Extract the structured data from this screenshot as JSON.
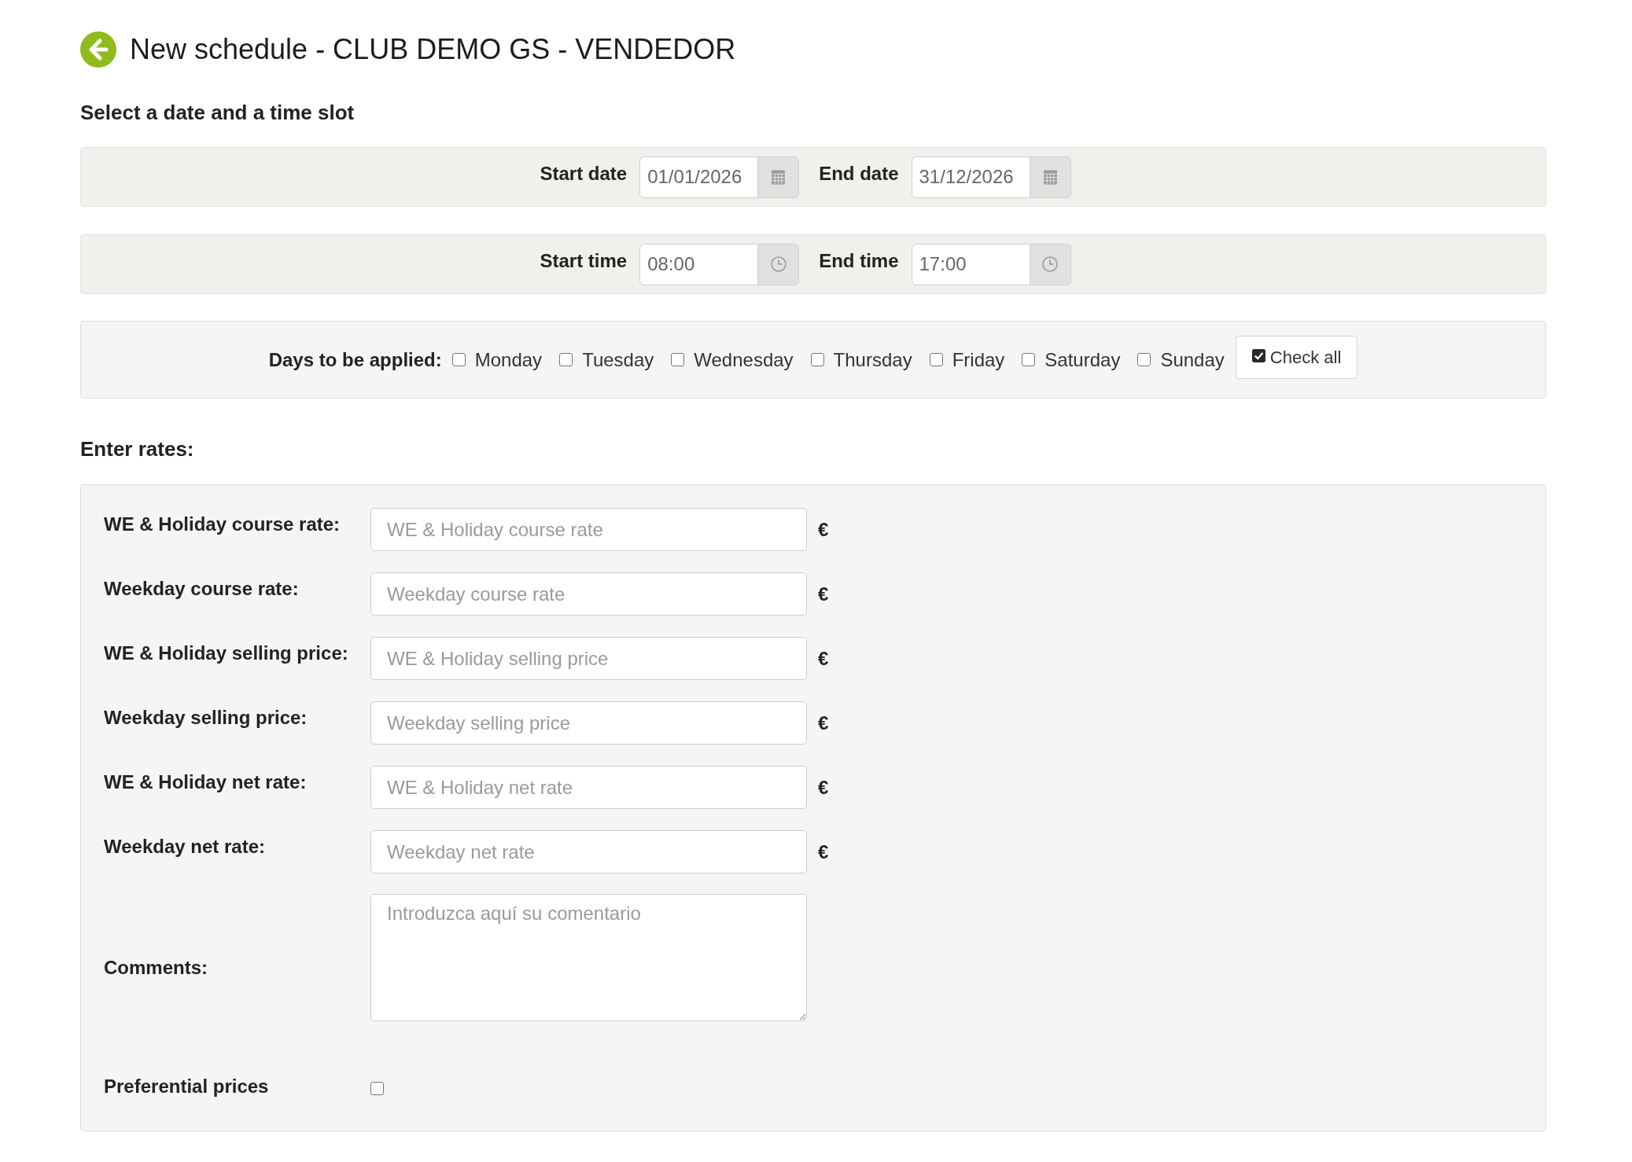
{
  "header": {
    "title": "New schedule - CLUB DEMO GS - VENDEDOR"
  },
  "schedule": {
    "heading": "Select a date and a time slot",
    "rows": [
      {
        "fields": [
          {
            "kind": "date",
            "label": "Start date",
            "value": "01/01/2026"
          },
          {
            "kind": "date",
            "label": "End date",
            "value": "31/12/2026"
          }
        ]
      },
      {
        "fields": [
          {
            "kind": "time",
            "label": "Start time",
            "value": "08:00"
          },
          {
            "kind": "time",
            "label": "End time",
            "value": "17:00"
          }
        ]
      }
    ]
  },
  "days": {
    "label": "Days to be applied:",
    "items": [
      {
        "label": "Monday",
        "checked": false
      },
      {
        "label": "Tuesday",
        "checked": false
      },
      {
        "label": "Wednesday",
        "checked": false
      },
      {
        "label": "Thursday",
        "checked": false
      },
      {
        "label": "Friday",
        "checked": false
      },
      {
        "label": "Saturday",
        "checked": false
      },
      {
        "label": "Sunday",
        "checked": false
      }
    ],
    "check_all_button": {
      "label": "Check all"
    }
  },
  "rates": {
    "heading": "Enter rates:",
    "fields": [
      {
        "kind": "amount",
        "label": "WE & Holiday course rate:",
        "placeholder": "WE & Holiday course rate",
        "unit": "€"
      },
      {
        "kind": "amount",
        "label": "Weekday course rate:",
        "placeholder": "Weekday course rate",
        "unit": "€"
      },
      {
        "kind": "amount",
        "label": "WE & Holiday selling price:",
        "placeholder": "WE & Holiday selling price",
        "unit": "€"
      },
      {
        "kind": "amount",
        "label": "Weekday selling price:",
        "placeholder": "Weekday selling price",
        "unit": "€"
      },
      {
        "kind": "amount",
        "label": "WE & Holiday net rate:",
        "placeholder": "WE & Holiday net rate",
        "unit": "€"
      },
      {
        "kind": "amount",
        "label": "Weekday net rate:",
        "placeholder": "Weekday net rate",
        "unit": "€"
      },
      {
        "kind": "textarea",
        "label": "Comments:",
        "placeholder": "Introduzca aquí su comentario"
      },
      {
        "kind": "checkbox",
        "label": "Preferential prices",
        "checked": false
      }
    ]
  }
}
